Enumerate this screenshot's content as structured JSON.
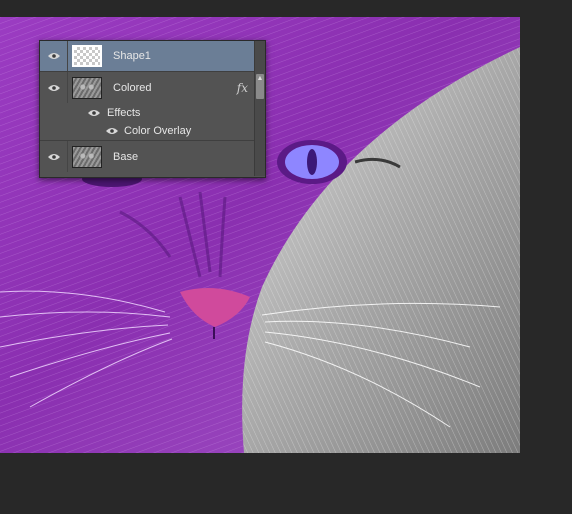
{
  "canvas": {
    "description_colors": {
      "purple": "#8b2fb0",
      "gray": "#9a9a9a",
      "background": "#282828"
    }
  },
  "layers_panel": {
    "layers": [
      {
        "name": "Shape1",
        "selected": true,
        "thumbnail": "transparent-checker"
      },
      {
        "name": "Colored",
        "selected": false,
        "thumbnail": "cat",
        "fx": "fx"
      },
      {
        "name": "Base",
        "selected": false,
        "thumbnail": "cat"
      }
    ],
    "effects_label": "Effects",
    "effect_items": [
      "Color Overlay"
    ],
    "icons": {
      "visibility": "eye-icon",
      "fx": "fx-icon",
      "scroll": "scroll-up-arrow-icon"
    }
  }
}
